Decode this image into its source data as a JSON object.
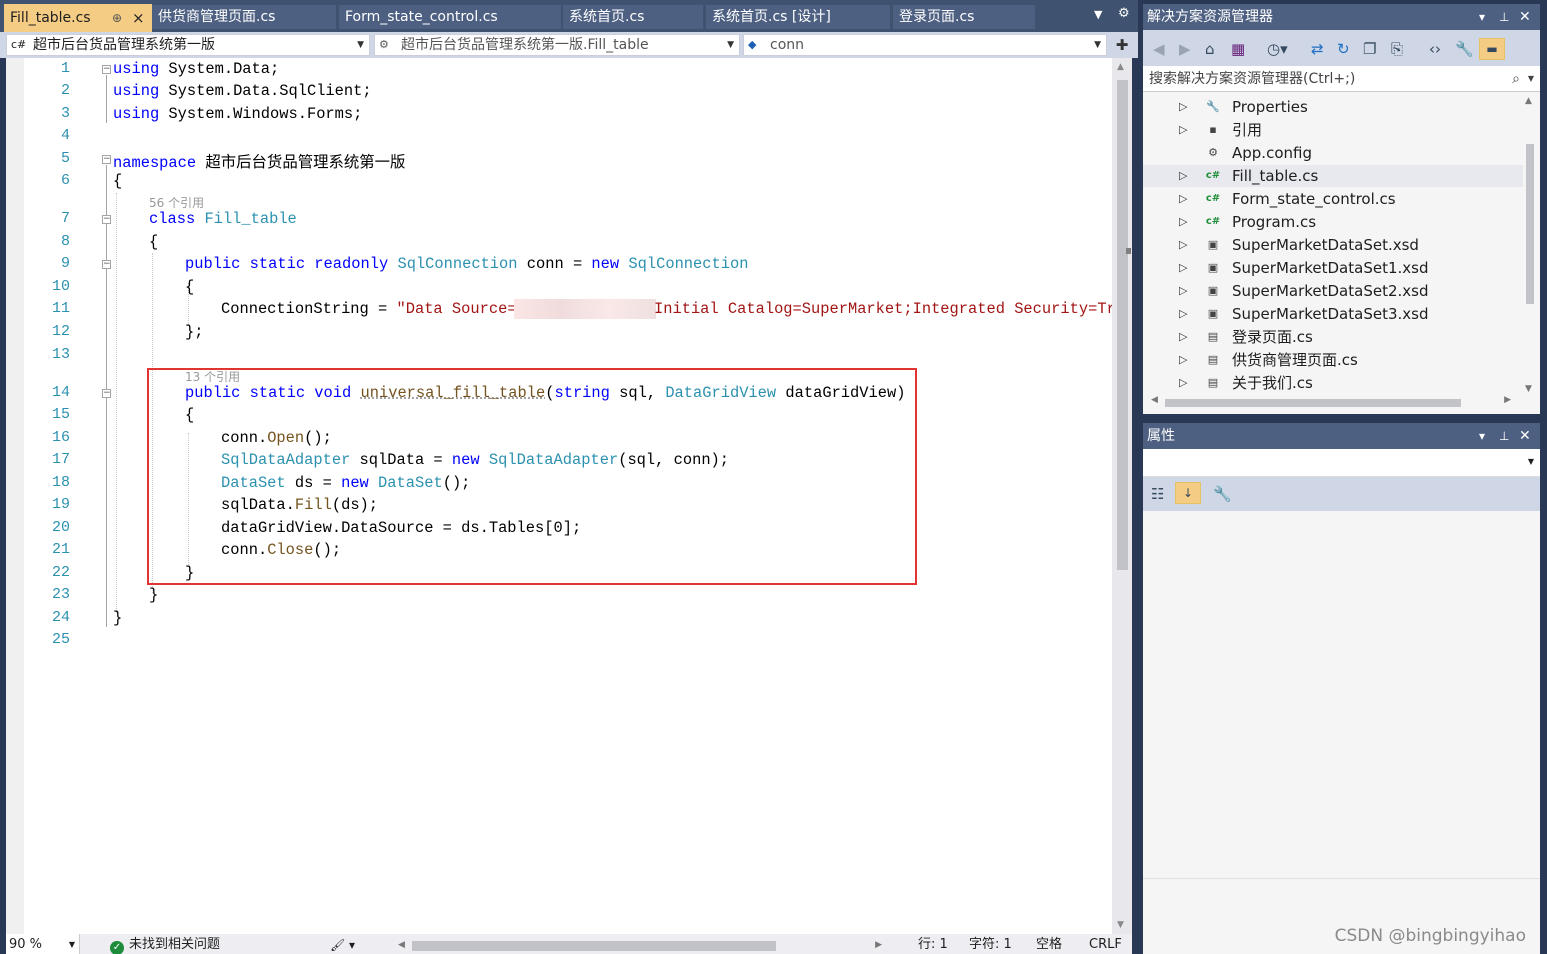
{
  "colors": {
    "ide_frame": "#293955",
    "active_tab": "#f5cc84",
    "keyword": "#0000ff",
    "type": "#2b91af",
    "string": "#a31515",
    "method": "#74531f",
    "line_number": "#2b91af",
    "highlight_box": "#e33434",
    "csharp_icon": "#1f8f3a"
  },
  "tabs": {
    "active": "Fill_table.cs",
    "active_pin": "⊕",
    "active_close": "×",
    "t2": "供货商管理页面.cs",
    "t3": "Form_state_control.cs",
    "t4": "系统首页.cs",
    "t5": "系统首页.cs [设计]",
    "t6": "登录页面.cs"
  },
  "navbar": {
    "project_icon": "c#",
    "project": "超市后台货品管理系统第一版",
    "class_icon": "⚙",
    "class": "超市后台货品管理系统第一版.Fill_table",
    "member_icon": "◆",
    "member": "conn"
  },
  "editor": {
    "line_numbers": [
      "1",
      "2",
      "3",
      "4",
      "5",
      "6",
      "7",
      "8",
      "9",
      "10",
      "11",
      "12",
      "13",
      "14",
      "15",
      "16",
      "17",
      "18",
      "19",
      "20",
      "21",
      "22",
      "23",
      "24",
      "25"
    ],
    "codelens_class": "56 个引用",
    "codelens_method": "13 个引用",
    "code": {
      "l1_kw": "using",
      "l1_rest": " System.Data;",
      "l2_kw": "using",
      "l2_rest": " System.Data.SqlClient;",
      "l3_kw": "using",
      "l3_rest": " System.Windows.Forms;",
      "l5_kw": "namespace",
      "l5_rest": " 超市后台货品管理系统第一版",
      "l6": "{",
      "l7_kw": "class",
      "l7_sp": " ",
      "l7_type": "Fill_table",
      "l8": "{",
      "l9_kw": "public static readonly",
      "l9_sp1": " ",
      "l9_type1": "SqlConnection",
      "l9_mid": " conn = ",
      "l9_kw2": "new",
      "l9_sp2": " ",
      "l9_type2": "SqlConnection",
      "l10": "{",
      "l11_pre": "ConnectionString = ",
      "l11_s1": "\"Data Source=",
      "l11_s2": "Initial Catalog=SuperMarket;Integrated Security=Tru",
      "l12": "};",
      "l14_kw": "public static void",
      "l14_sp": " ",
      "l14_method": "universal_fill_table",
      "l14_p1": "(",
      "l14_kw2": "string",
      "l14_p2": " sql, ",
      "l14_type": "DataGridView",
      "l14_p3": " dataGridView)",
      "l15": "{",
      "l16_a": "conn.",
      "l16_m": "Open",
      "l16_b": "();",
      "l17_t1": "SqlDataAdapter",
      "l17_a": " sqlData = ",
      "l17_kw": "new",
      "l17_sp": " ",
      "l17_t2": "SqlDataAdapter",
      "l17_b": "(sql, conn);",
      "l18_t1": "DataSet",
      "l18_a": " ds = ",
      "l18_kw": "new",
      "l18_sp": " ",
      "l18_t2": "DataSet",
      "l18_b": "();",
      "l19_a": "sqlData.",
      "l19_m": "Fill",
      "l19_b": "(ds);",
      "l20": "dataGridView.DataSource = ds.Tables[0];",
      "l21_a": "conn.",
      "l21_m": "Close",
      "l21_b": "();",
      "l22": "}",
      "l23": "}",
      "l24": "}"
    }
  },
  "statusbar": {
    "zoom": "90 %",
    "status_icon": "✓",
    "issues": "未找到相关问题",
    "line": "行: 1",
    "char": "字符: 1",
    "spaces": "空格",
    "eol": "CRLF"
  },
  "solution_explorer": {
    "title": "解决方案资源管理器",
    "search_placeholder": "搜索解决方案资源管理器(Ctrl+;)",
    "items": [
      {
        "label": "Properties",
        "icon": "🔧"
      },
      {
        "label": "引用",
        "icon": "▪"
      },
      {
        "label": "App.config",
        "icon": "⚙"
      },
      {
        "label": "Fill_table.cs",
        "icon": "c#"
      },
      {
        "label": "Form_state_control.cs",
        "icon": "c#"
      },
      {
        "label": "Program.cs",
        "icon": "c#"
      },
      {
        "label": "SuperMarketDataSet.xsd",
        "icon": "▣"
      },
      {
        "label": "SuperMarketDataSet1.xsd",
        "icon": "▣"
      },
      {
        "label": "SuperMarketDataSet2.xsd",
        "icon": "▣"
      },
      {
        "label": "SuperMarketDataSet3.xsd",
        "icon": "▣"
      },
      {
        "label": "登录页面.cs",
        "icon": "▤"
      },
      {
        "label": "供货商管理页面.cs",
        "icon": "▤"
      },
      {
        "label": "关于我们.cs",
        "icon": "▤"
      }
    ]
  },
  "properties": {
    "title": "属性"
  },
  "watermark": "CSDN @bingbingyihao"
}
